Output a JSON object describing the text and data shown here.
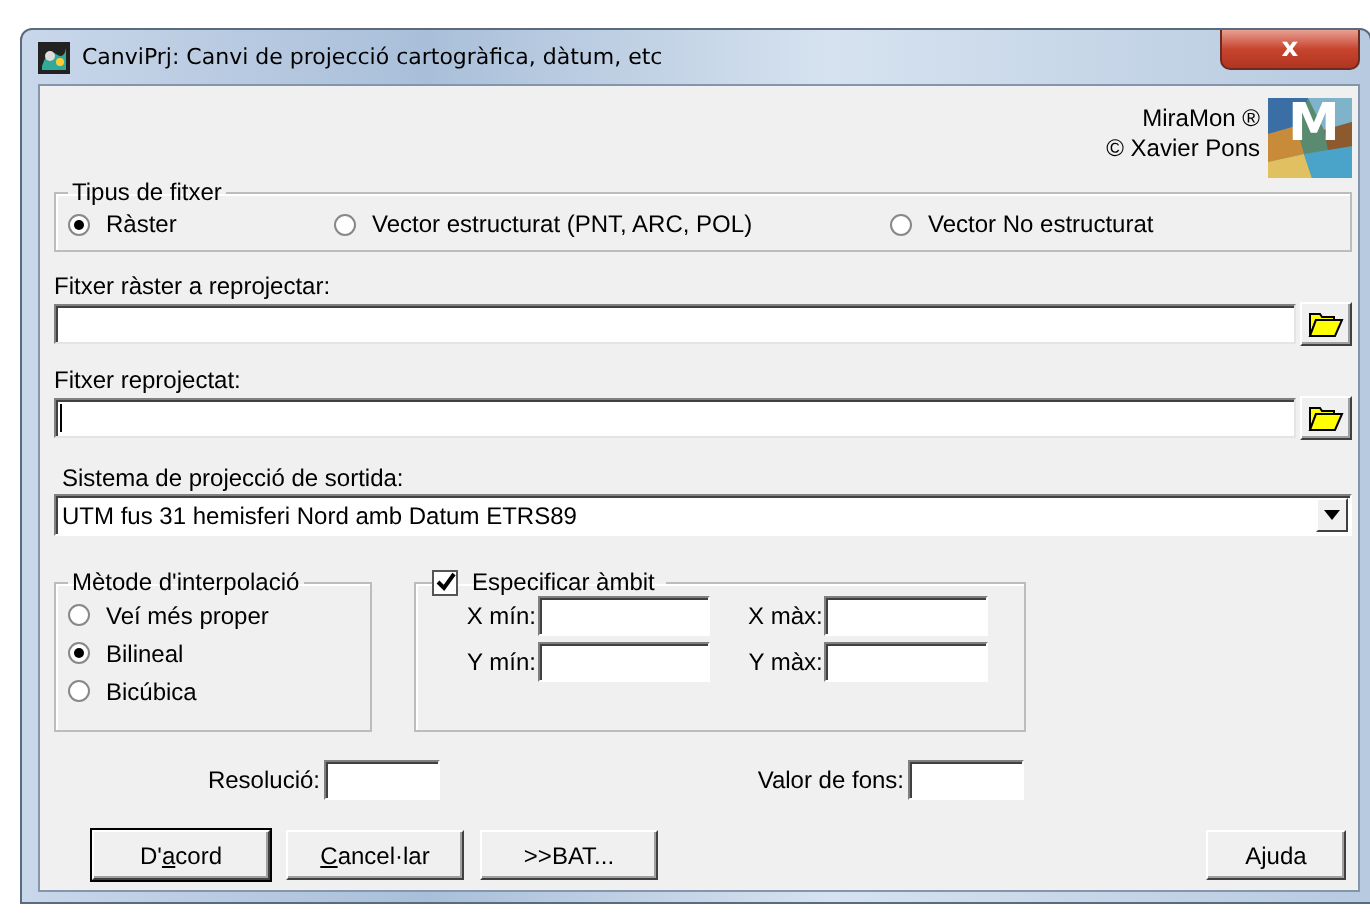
{
  "window": {
    "title": "CanviPrj: Canvi de projecció cartogràfica, dàtum, etc",
    "close": "x"
  },
  "credits": [
    "MiraMon ®",
    "© Xavier Pons"
  ],
  "logo": {
    "text": "M"
  },
  "file_type": {
    "label": "Tipus de fitxer",
    "options": [
      {
        "label": "Ràster",
        "selected": true
      },
      {
        "label": "Vector estructurat (PNT, ARC, POL)",
        "selected": false
      },
      {
        "label": "Vector No estructurat",
        "selected": false
      }
    ]
  },
  "input_file": {
    "label": "Fitxer ràster a reprojectar:",
    "focused": false
  },
  "output_file": {
    "label": "Fitxer reprojectat:",
    "focused": true
  },
  "output_projection": {
    "label": "Sistema de projecció de sortida:",
    "value": "UTM fus 31 hemisferi Nord amb Datum ETRS89"
  },
  "interpolation": {
    "label": "Mètode d'interpolació",
    "options": [
      {
        "label": "Veí més proper",
        "selected": false
      },
      {
        "label": "Bilineal",
        "selected": true
      },
      {
        "label": "Bicúbica",
        "selected": false
      }
    ]
  },
  "extent": {
    "label": "Especificar àmbit",
    "checked": true,
    "fields": [
      {
        "label": "X mín:"
      },
      {
        "label": "X màx:"
      },
      {
        "label": "Y mín:"
      },
      {
        "label": "Y màx:"
      }
    ]
  },
  "resolution": {
    "label": "Resolució:"
  },
  "background_value": {
    "label": "Valor de fons:"
  },
  "buttons": [
    {
      "pre": "D'",
      "key": "a",
      "post": "cord",
      "default": true
    },
    {
      "key": "C",
      "post": "ancel·lar",
      "default": false
    },
    {
      "pre": ">>BAT...",
      "default": false
    }
  ],
  "help_button": {
    "label": "Ajuda"
  }
}
